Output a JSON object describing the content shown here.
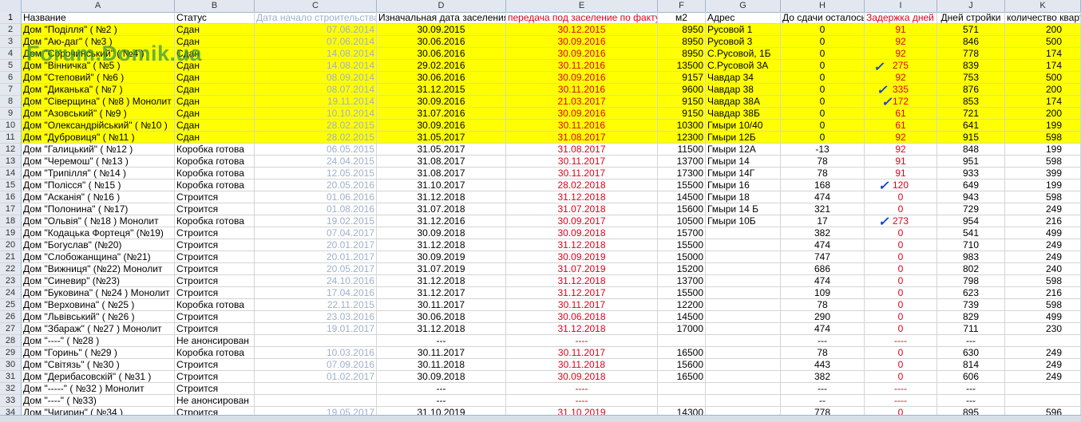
{
  "columns": [
    "A",
    "B",
    "C",
    "D",
    "E",
    "F",
    "G",
    "H",
    "I",
    "J",
    "K"
  ],
  "header": {
    "row_num": "1",
    "a": "Название",
    "b": "Статус",
    "c": "Дата начало строительства",
    "d": "Изначальная дата заселения",
    "e": "передача под заселение по факту",
    "f": "м2",
    "g": "Адрес",
    "h": "До сдачи осталось",
    "i": "Задержка дней",
    "j": "Дней стройки",
    "k": "количество квартир"
  },
  "watermark": "Forum.Domik.ua",
  "check_mark": "✓",
  "colors": {
    "highlight": "#ffff00",
    "red_text": "#e0001a",
    "start_date": "#9db0cc",
    "check": "#1a3fd0"
  },
  "rows": [
    {
      "n": "2",
      "a": "Дом \"Поділля\" ( №2 )",
      "b": "Сдан",
      "c": "07.06.2014",
      "d": "30.09.2015",
      "e": "30.12.2015",
      "f": "8950",
      "g": "Русовой 1",
      "h": "0",
      "i": "91",
      "j": "571",
      "k": "200",
      "hl": true
    },
    {
      "n": "3",
      "a": "Дом \"Аю-даг\" ( №3 )",
      "b": "Сдан",
      "c": "07.06.2014",
      "d": "30.06.2016",
      "e": "30.09.2016",
      "f": "8950",
      "g": "Русовой 3",
      "h": "0",
      "i": "92",
      "j": "846",
      "k": "500",
      "hl": true
    },
    {
      "n": "4",
      "a": "Дом \"Сорочинський\" ( №4 )",
      "b": "Сдан",
      "c": "14.08.2014",
      "d": "30.06.2016",
      "e": "30.09.2016",
      "f": "8950",
      "g": "С.Русовой, 1Б",
      "h": "0",
      "i": "92",
      "j": "778",
      "k": "174",
      "hl": true
    },
    {
      "n": "5",
      "a": "Дом \"Вінничка\" ( №5 )",
      "b": "Сдан",
      "c": "14.08.2014",
      "d": "29.02.2016",
      "e": "30.11.2016",
      "f": "13500",
      "g": "С.Русовой 3А",
      "h": "0",
      "i": "275",
      "j": "839",
      "k": "174",
      "hl": true
    },
    {
      "n": "6",
      "a": "Дом \"Степовий\" ( №6 )",
      "b": "Сдан",
      "c": "08.09.2014",
      "d": "30.06.2016",
      "e": "30.09.2016",
      "f": "9157",
      "g": "Чавдар 34",
      "h": "0",
      "i": "92",
      "j": "753",
      "k": "500",
      "hl": true
    },
    {
      "n": "7",
      "a": "Дом \"Диканька\" ( №7 )",
      "b": "Сдан",
      "c": "08.07.2014",
      "d": "31.12.2015",
      "e": "30.11.2016",
      "f": "9600",
      "g": "Чавдар 38",
      "h": "0",
      "i": "335",
      "j": "876",
      "k": "200",
      "hl": true
    },
    {
      "n": "8",
      "a": "Дом \"Сіверщина\" ( №8 ) Монолит",
      "b": "Сдан",
      "c": "19.11.2014",
      "d": "30.09.2016",
      "e": "21.03.2017",
      "f": "9150",
      "g": "Чавдар 38А",
      "h": "0",
      "i": "172",
      "j": "853",
      "k": "174",
      "hl": true
    },
    {
      "n": "9",
      "a": "Дом \"Азовський\" ( №9 )",
      "b": "Сдан",
      "c": "10.10.2014",
      "d": "31.07.2016",
      "e": "30.09.2016",
      "f": "9150",
      "g": "Чавдар 38Б",
      "h": "0",
      "i": "61",
      "j": "721",
      "k": "200",
      "hl": true
    },
    {
      "n": "10",
      "a": "Дом \"Олександрійський\" ( №10 )",
      "b": "Сдан",
      "c": "28.02.2015",
      "d": "30.09.2016",
      "e": "30.11.2016",
      "f": "10300",
      "g": "Гмыри 10/40",
      "h": "0",
      "i": "61",
      "j": "641",
      "k": "199",
      "hl": true
    },
    {
      "n": "11",
      "a": "Дом \"Дубровиця\" ( №11 )",
      "b": "Сдан",
      "c": "28.02.2015",
      "d": "31.05.2017",
      "e": "31.08.2017",
      "f": "12300",
      "g": "Гмыри 12Б",
      "h": "0",
      "i": "92",
      "j": "915",
      "k": "598",
      "hl": true
    },
    {
      "n": "12",
      "a": "Дом \"Галицький\" ( №12 )",
      "b": "Коробка готова",
      "c": "06.05.2015",
      "d": "31.05.2017",
      "e": "31.08.2017",
      "f": "11500",
      "g": "Гмыри 12А",
      "h": "-13",
      "i": "92",
      "j": "848",
      "k": "199",
      "hl": false
    },
    {
      "n": "13",
      "a": "Дом \"Черемош\" ( №13 )",
      "b": "Коробка готова",
      "c": "24.04.2015",
      "d": "31.08.2017",
      "e": "30.11.2017",
      "f": "13700",
      "g": "Гмыри 14",
      "h": "78",
      "i": "91",
      "j": "951",
      "k": "598",
      "hl": false
    },
    {
      "n": "14",
      "a": "Дом \"Трипілля\" ( №14 )",
      "b": "Коробка готова",
      "c": "12.05.2015",
      "d": "31.08.2017",
      "e": "30.11.2017",
      "f": "17300",
      "g": "Гмыри 14Г",
      "h": "78",
      "i": "91",
      "j": "933",
      "k": "399",
      "hl": false
    },
    {
      "n": "15",
      "a": "Дом \"Полісся\" ( №15 )",
      "b": "Коробка готова",
      "c": "20.05.2016",
      "d": "31.10.2017",
      "e": "28.02.2018",
      "f": "15500",
      "g": "Гмыри 16",
      "h": "168",
      "i": "120",
      "j": "649",
      "k": "199",
      "hl": false
    },
    {
      "n": "16",
      "a": "Дом \"Асканія\" ( №16 )",
      "b": "Строится",
      "c": "01.06.2016",
      "d": "31.12.2018",
      "e": "31.12.2018",
      "f": "14500",
      "g": "Гмыри 18",
      "h": "474",
      "i": "0",
      "j": "943",
      "k": "598",
      "hl": false
    },
    {
      "n": "17",
      "a": "Дом \"Полонина\" ( №17)",
      "b": "Строится",
      "c": "01.08.2016",
      "d": "31.07.2018",
      "e": "31.07.2018",
      "f": "15600",
      "g": "Гмыри 14 Б",
      "h": "321",
      "i": "0",
      "j": "729",
      "k": "249",
      "hl": false
    },
    {
      "n": "18",
      "a": "Дом \"Ольвія\" ( №18 ) Монолит",
      "b": "Коробка готова",
      "c": "19.02.2015",
      "d": "31.12.2016",
      "e": "30.09.2017",
      "f": "10500",
      "g": "Гмыри 10Б",
      "h": "17",
      "i": "273",
      "j": "954",
      "k": "216",
      "hl": false
    },
    {
      "n": "19",
      "a": "Дом \"Кодацька Фортеця\" (№19)",
      "b": "Строится",
      "c": "07.04.2017",
      "d": "30.09.2018",
      "e": "30.09.2018",
      "f": "15700",
      "g": "",
      "h": "382",
      "i": "0",
      "j": "541",
      "k": "499",
      "hl": false
    },
    {
      "n": "20",
      "a": "Дом \"Богуслав\" (№20)",
      "b": "Строится",
      "c": "20.01.2017",
      "d": "31.12.2018",
      "e": "31.12.2018",
      "f": "15500",
      "g": "",
      "h": "474",
      "i": "0",
      "j": "710",
      "k": "249",
      "hl": false
    },
    {
      "n": "21",
      "a": "Дом \"Слобожанщина\" (№21)",
      "b": "Строится",
      "c": "20.01.2017",
      "d": "30.09.2019",
      "e": "30.09.2019",
      "f": "15000",
      "g": "",
      "h": "747",
      "i": "0",
      "j": "983",
      "k": "249",
      "hl": false
    },
    {
      "n": "22",
      "a": "Дом \"Вижниця\" (№22) Монолит",
      "b": "Строится",
      "c": "20.05.2017",
      "d": "31.07.2019",
      "e": "31.07.2019",
      "f": "15200",
      "g": "",
      "h": "686",
      "i": "0",
      "j": "802",
      "k": "240",
      "hl": false
    },
    {
      "n": "23",
      "a": "Дом \"Синевир\" (№23)",
      "b": "Строится",
      "c": "24.10.2016",
      "d": "31.12.2018",
      "e": "31.12.2018",
      "f": "13700",
      "g": "",
      "h": "474",
      "i": "0",
      "j": "798",
      "k": "598",
      "hl": false
    },
    {
      "n": "24",
      "a": "Дом \"Буковина\" ( №24 ) Монолит",
      "b": "Строится",
      "c": "17.04.2016",
      "d": "31.12.2017",
      "e": "31.12.2017",
      "f": "15500",
      "g": "",
      "h": "109",
      "i": "0",
      "j": "623",
      "k": "216",
      "hl": false
    },
    {
      "n": "25",
      "a": "Дом \"Верховина\" ( №25 )",
      "b": "Коробка готова",
      "c": "22.11.2015",
      "d": "30.11.2017",
      "e": "30.11.2017",
      "f": "12200",
      "g": "",
      "h": "78",
      "i": "0",
      "j": "739",
      "k": "598",
      "hl": false
    },
    {
      "n": "26",
      "a": "Дом \"Львівський\" ( №26 )",
      "b": "Строится",
      "c": "23.03.2016",
      "d": "30.06.2018",
      "e": "30.06.2018",
      "f": "14500",
      "g": "",
      "h": "290",
      "i": "0",
      "j": "829",
      "k": "499",
      "hl": false
    },
    {
      "n": "27",
      "a": "Дом \"Збараж\" ( №27 ) Монолит",
      "b": "Строится",
      "c": "19.01.2017",
      "d": "31.12.2018",
      "e": "31.12.2018",
      "f": "17000",
      "g": "",
      "h": "474",
      "i": "0",
      "j": "711",
      "k": "230",
      "hl": false
    },
    {
      "n": "28",
      "a": "Дом \"----\" ( №28 )",
      "b": "Не анонсирован",
      "c": "",
      "d": "---",
      "e": "----",
      "f": "",
      "g": "",
      "h": "---",
      "i": "----",
      "j": "---",
      "k": "",
      "hl": false
    },
    {
      "n": "29",
      "a": "Дом \"Горинь\" ( №29 )",
      "b": "Коробка готова",
      "c": "10.03.2016",
      "d": "30.11.2017",
      "e": "30.11.2017",
      "f": "16500",
      "g": "",
      "h": "78",
      "i": "0",
      "j": "630",
      "k": "249",
      "hl": false
    },
    {
      "n": "30",
      "a": "Дом \"Світязь\" ( №30 )",
      "b": "Строится",
      "c": "07.09.2016",
      "d": "30.11.2018",
      "e": "30.11.2018",
      "f": "15600",
      "g": "",
      "h": "443",
      "i": "0",
      "j": "814",
      "k": "249",
      "hl": false
    },
    {
      "n": "31",
      "a": "Дом \"Дерибасовскій\" ( №31 )",
      "b": "Строится",
      "c": "01.02.2017",
      "d": "30.09.2018",
      "e": "30.09.2018",
      "f": "16500",
      "g": "",
      "h": "382",
      "i": "0",
      "j": "606",
      "k": "249",
      "hl": false
    },
    {
      "n": "32",
      "a": "Дом \"-----\" ( №32 ) Монолит",
      "b": "Строится",
      "c": "",
      "d": "---",
      "e": "----",
      "f": "",
      "g": "",
      "h": "---",
      "i": "----",
      "j": "---",
      "k": "",
      "hl": false
    },
    {
      "n": "33",
      "a": "Дом \"----\" ( №33)",
      "b": "Не анонсирован",
      "c": "",
      "d": "---",
      "e": "----",
      "f": "",
      "g": "",
      "h": "--",
      "i": "----",
      "j": "---",
      "k": "",
      "hl": false
    },
    {
      "n": "34",
      "a": "Дом \"Чигирин\" ( №34 )",
      "b": "Строится",
      "c": "19.05.2017",
      "d": "31.10.2019",
      "e": "31.10.2019",
      "f": "14300",
      "g": "",
      "h": "778",
      "i": "0",
      "j": "895",
      "k": "596",
      "hl": false
    }
  ]
}
